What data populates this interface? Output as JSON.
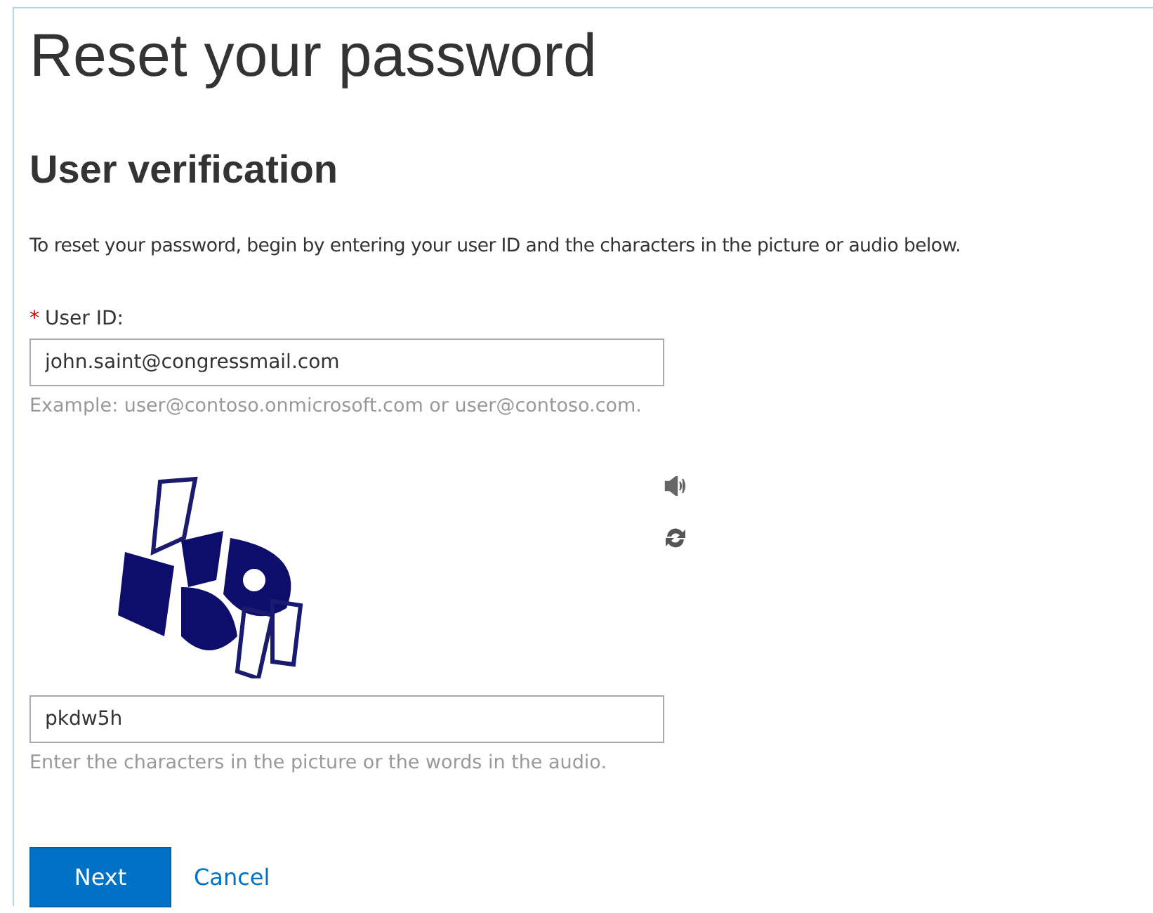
{
  "title": "Reset your password",
  "subtitle": "User verification",
  "instructions": "To reset your password, begin by entering your user ID and the characters in the picture or audio below.",
  "user_id": {
    "required_mark": "*",
    "label": "User ID:",
    "value": "john.saint@congressmail.com",
    "hint": "Example: user@contoso.onmicrosoft.com or user@contoso.com."
  },
  "captcha": {
    "kind": "picture",
    "value": "pkdw5h",
    "hint": "Enter the characters in the picture or the words in the audio."
  },
  "buttons": [
    {
      "kind": "primary",
      "label": "Next"
    },
    {
      "kind": "link",
      "label": "Cancel"
    }
  ]
}
